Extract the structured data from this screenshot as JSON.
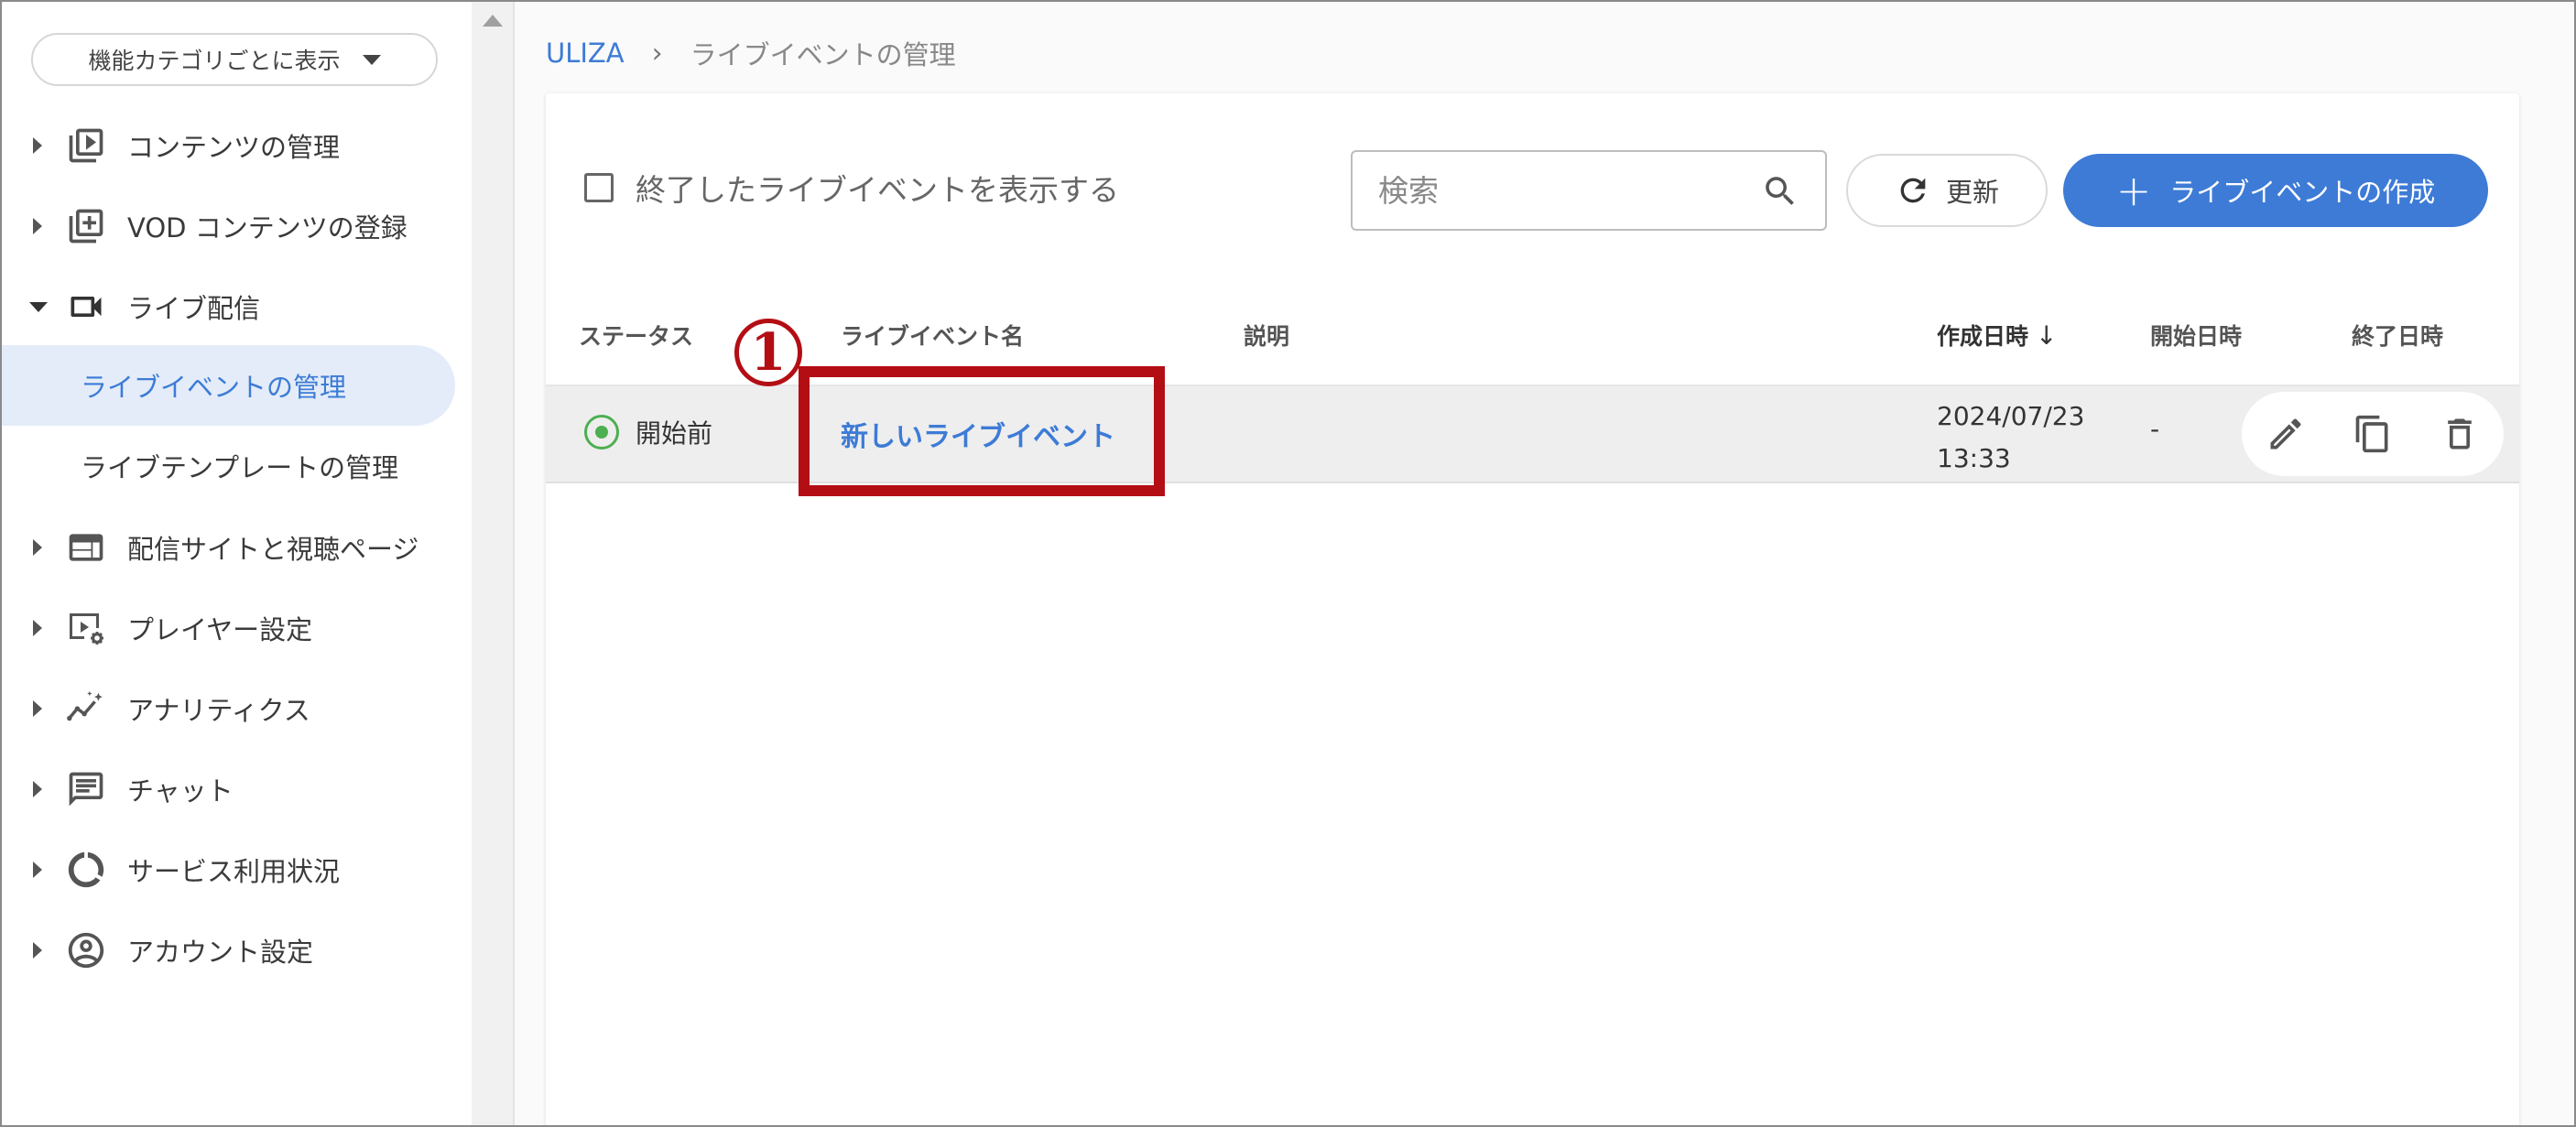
{
  "sidebar": {
    "category_select": "機能カテゴリごとに表示",
    "items": [
      {
        "label": "コンテンツの管理",
        "icon": "play-box-icon"
      },
      {
        "label": "VOD コンテンツの登録",
        "icon": "add-box-icon"
      },
      {
        "label": "ライブ配信",
        "icon": "video-camera-icon",
        "expanded": true
      },
      {
        "label": "配信サイトと視聴ページ",
        "icon": "web-page-icon"
      },
      {
        "label": "プレイヤー設定",
        "icon": "player-settings-icon"
      },
      {
        "label": "アナリティクス",
        "icon": "analytics-icon"
      },
      {
        "label": "チャット",
        "icon": "chat-icon"
      },
      {
        "label": "サービス利用状況",
        "icon": "usage-donut-icon"
      },
      {
        "label": "アカウント設定",
        "icon": "account-circle-icon"
      }
    ],
    "subitems": [
      {
        "label": "ライブイベントの管理",
        "active": true
      },
      {
        "label": "ライブテンプレートの管理",
        "active": false
      }
    ]
  },
  "breadcrumb": {
    "root": "ULIZA",
    "separator": "›",
    "current": "ライブイベントの管理"
  },
  "toolbar": {
    "show_ended_label": "終了したライブイベントを表示する",
    "search_placeholder": "検索",
    "refresh_label": "更新",
    "create_label": "ライブイベントの作成"
  },
  "table": {
    "columns": [
      "ステータス",
      "ライブイベント名",
      "説明",
      "作成日時",
      "開始日時",
      "終了日時"
    ],
    "sort_arrow": "↓",
    "rows": [
      {
        "status": "開始前",
        "name": "新しいライブイベント",
        "description": "",
        "created_date": "2024/07/23",
        "created_time": "13:33",
        "start": "-",
        "end": ""
      }
    ]
  },
  "annotation": {
    "number": "1"
  },
  "colors": {
    "accent": "#3d7bd6",
    "status_green": "#4caf50",
    "annotation_red": "#b30e14",
    "active_nav_bg": "#e3ecf8"
  }
}
